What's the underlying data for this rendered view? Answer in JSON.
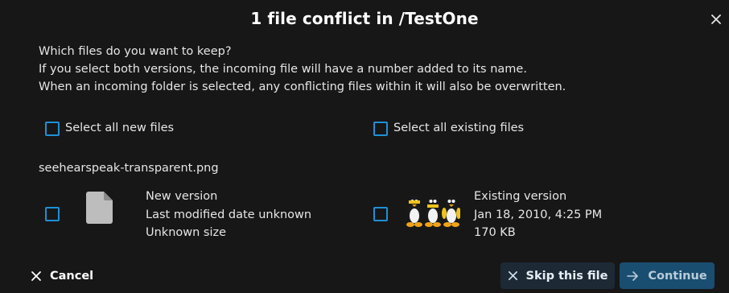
{
  "dialog": {
    "title": "1 file conflict in /TestOne",
    "intro": [
      "Which files do you want to keep?",
      "If you select both versions, the incoming file will have a number added to its name.",
      "When an incoming folder is selected, any conflicting files within it will also be overwritten."
    ]
  },
  "select_all": {
    "new_label": "Select all new files",
    "existing_label": "Select all existing files",
    "new_checked": false,
    "existing_checked": false
  },
  "conflict": {
    "filename": "seehearspeak-transparent.png",
    "new_version": {
      "heading": "New version",
      "date": "Last modified date unknown",
      "size": "Unknown size",
      "icon": "file-icon",
      "checked": false
    },
    "existing_version": {
      "heading": "Existing version",
      "date": "Jan 18, 2010, 4:25 PM",
      "size": "170 KB",
      "icon": "tux-thumbnail",
      "checked": false
    }
  },
  "buttons": {
    "cancel": "Cancel",
    "skip": "Skip this file",
    "continue": "Continue"
  },
  "colors": {
    "background": "#171717",
    "checkbox_border": "#1e90d6",
    "continue_bg": "#1a4e71",
    "skip_bg": "#1d2a36"
  }
}
